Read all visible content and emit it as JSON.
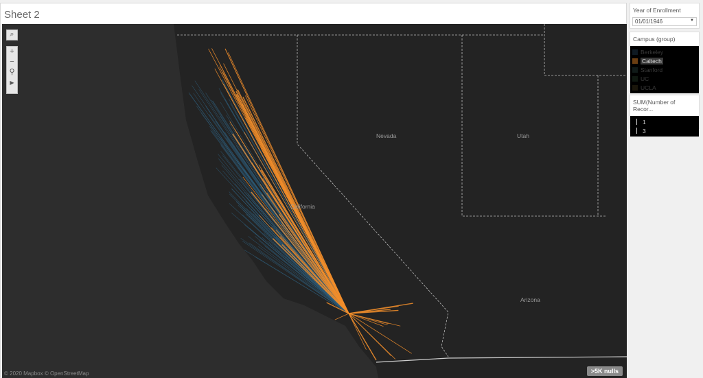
{
  "sheet": {
    "title": "Sheet 2"
  },
  "map": {
    "labels": {
      "nevada": "Nevada",
      "utah": "Utah",
      "california": "California",
      "arizona": "Arizona"
    },
    "attribution": "© 2020 Mapbox © OpenStreetMap",
    "nulls_badge": ">5K nulls",
    "colors": {
      "caltech": "#f28e2b",
      "other": "#2e5f7d",
      "land": "#232323",
      "ocean": "#2d2d2d"
    }
  },
  "filters": {
    "year_title": "Year of Enrollment",
    "year_value": "01/01/1946"
  },
  "legend": {
    "title": "Campus (group)",
    "items": [
      {
        "label": "Berkeley",
        "color": "#0f1a22"
      },
      {
        "label": "Caltech",
        "color": "#6a3e12"
      },
      {
        "label": "Stanford",
        "color": "#101a18"
      },
      {
        "label": "UC",
        "color": "#0f1810"
      },
      {
        "label": "UCLA",
        "color": "#1a160b"
      }
    ],
    "selected": "Caltech"
  },
  "size_legend": {
    "title": "SUM(Number of Recor...",
    "items": [
      "1",
      "3"
    ]
  }
}
